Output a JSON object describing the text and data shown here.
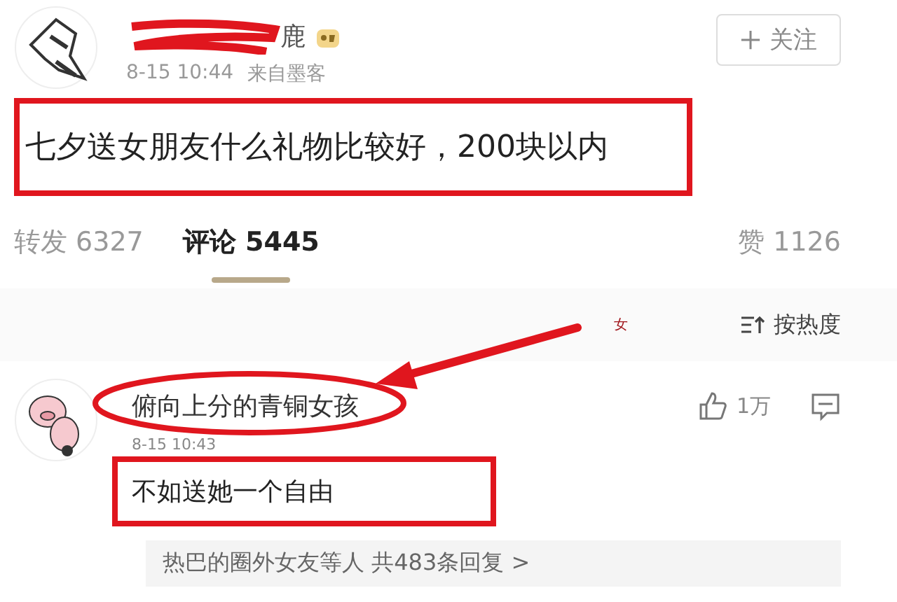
{
  "post": {
    "author": "鹿",
    "time": "8-15 10:44",
    "source": "来自墨客",
    "follow": "关注",
    "text": "七夕送女朋友什么礼物比较好，200块以内"
  },
  "tabs": [
    {
      "label": "转发",
      "count": "6327",
      "selected": false
    },
    {
      "label": "评论",
      "count": "5445",
      "selected": true
    },
    {
      "label": "赞",
      "count": "1126",
      "selected": false
    }
  ],
  "sort": {
    "mark": "女",
    "label": "按热度"
  },
  "comment": {
    "author": "俯向上分的青铜女孩",
    "time": "8-15 10:43",
    "text": "不如送她一个自由",
    "likes": "1万",
    "replies": "热巴的圈外女友等人  共483条回复 >"
  }
}
